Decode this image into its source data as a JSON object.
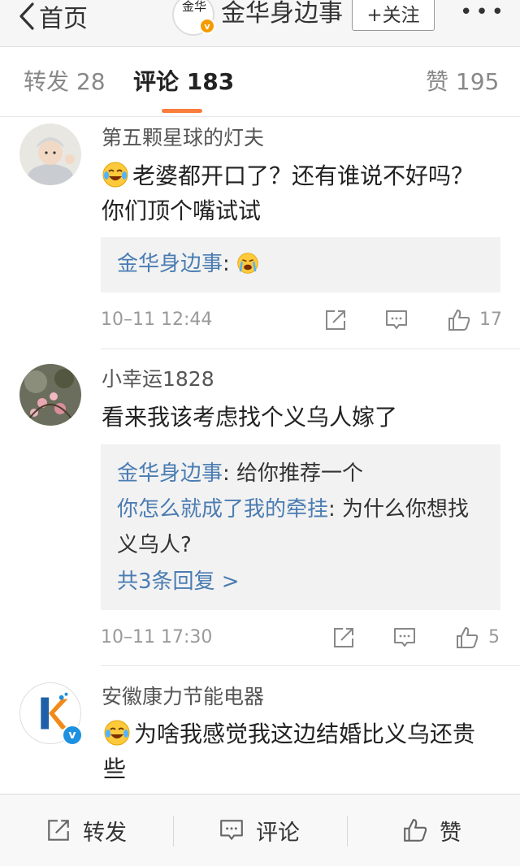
{
  "nav": {
    "back_label": "首页",
    "account_name": "金华身边事",
    "avatar_glyph": "金华",
    "verified_badge": "v",
    "follow_label": "+关注",
    "more_label": "•••"
  },
  "tabs": {
    "repost": "转发 28",
    "comments": "评论 183",
    "likes": "赞 195"
  },
  "comments": [
    {
      "username": "第五颗星球的灯夫",
      "emoji": "laugh-cry",
      "text": "老婆都开口了？还有谁说不好吗？你们顶个嘴试试",
      "replies": [
        {
          "user": "金华身边事",
          "sep": ":",
          "text": "",
          "emoji": "laugh-cry"
        }
      ],
      "time": "10–11 12:44",
      "like_count": "17"
    },
    {
      "username": "小幸运1828",
      "text": "看来我该考虑找个义乌人嫁了",
      "replies": [
        {
          "user": "金华身边事",
          "sep": ":",
          "text": " 给你推荐一个"
        },
        {
          "user": "你怎么就成了我的牵挂",
          "sep": ":",
          "text": " 为什么你想找义乌人?"
        }
      ],
      "more_replies": "共3条回复 >",
      "time": "10–11 17:30",
      "like_count": "5"
    },
    {
      "username": "安徽康力节能电器",
      "emoji": "laugh-cry",
      "text": "为啥我感觉我这边结婚比义乌还贵些",
      "verified_badge": "v"
    }
  ],
  "bottom_bar": {
    "repost": "转发",
    "comment": "评论",
    "like": "赞"
  },
  "colors": {
    "accent": "#fa7d3c",
    "link": "#4a7cb2",
    "verified_orange": "#f49b00",
    "verified_blue": "#1e90e0"
  }
}
